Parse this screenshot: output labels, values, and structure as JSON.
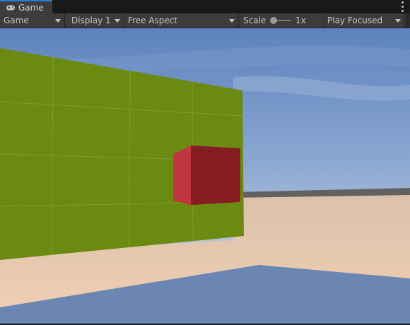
{
  "tab": {
    "title": "Game",
    "icon": "gamepad-icon"
  },
  "menu_icon": "more-options-icon",
  "toolbar": {
    "mode": "Game",
    "display": "Display 1",
    "aspect": "Free Aspect",
    "scale_label": "Scale",
    "scale_value": "1x",
    "scale_level": 0.0,
    "play_mode": "Play Focused"
  },
  "scene": {
    "sky_color": "#6d8fc4",
    "ground_color": "#e7c4a8",
    "wall_color": "#6b8a12",
    "cube_color": "#8a1c22"
  }
}
